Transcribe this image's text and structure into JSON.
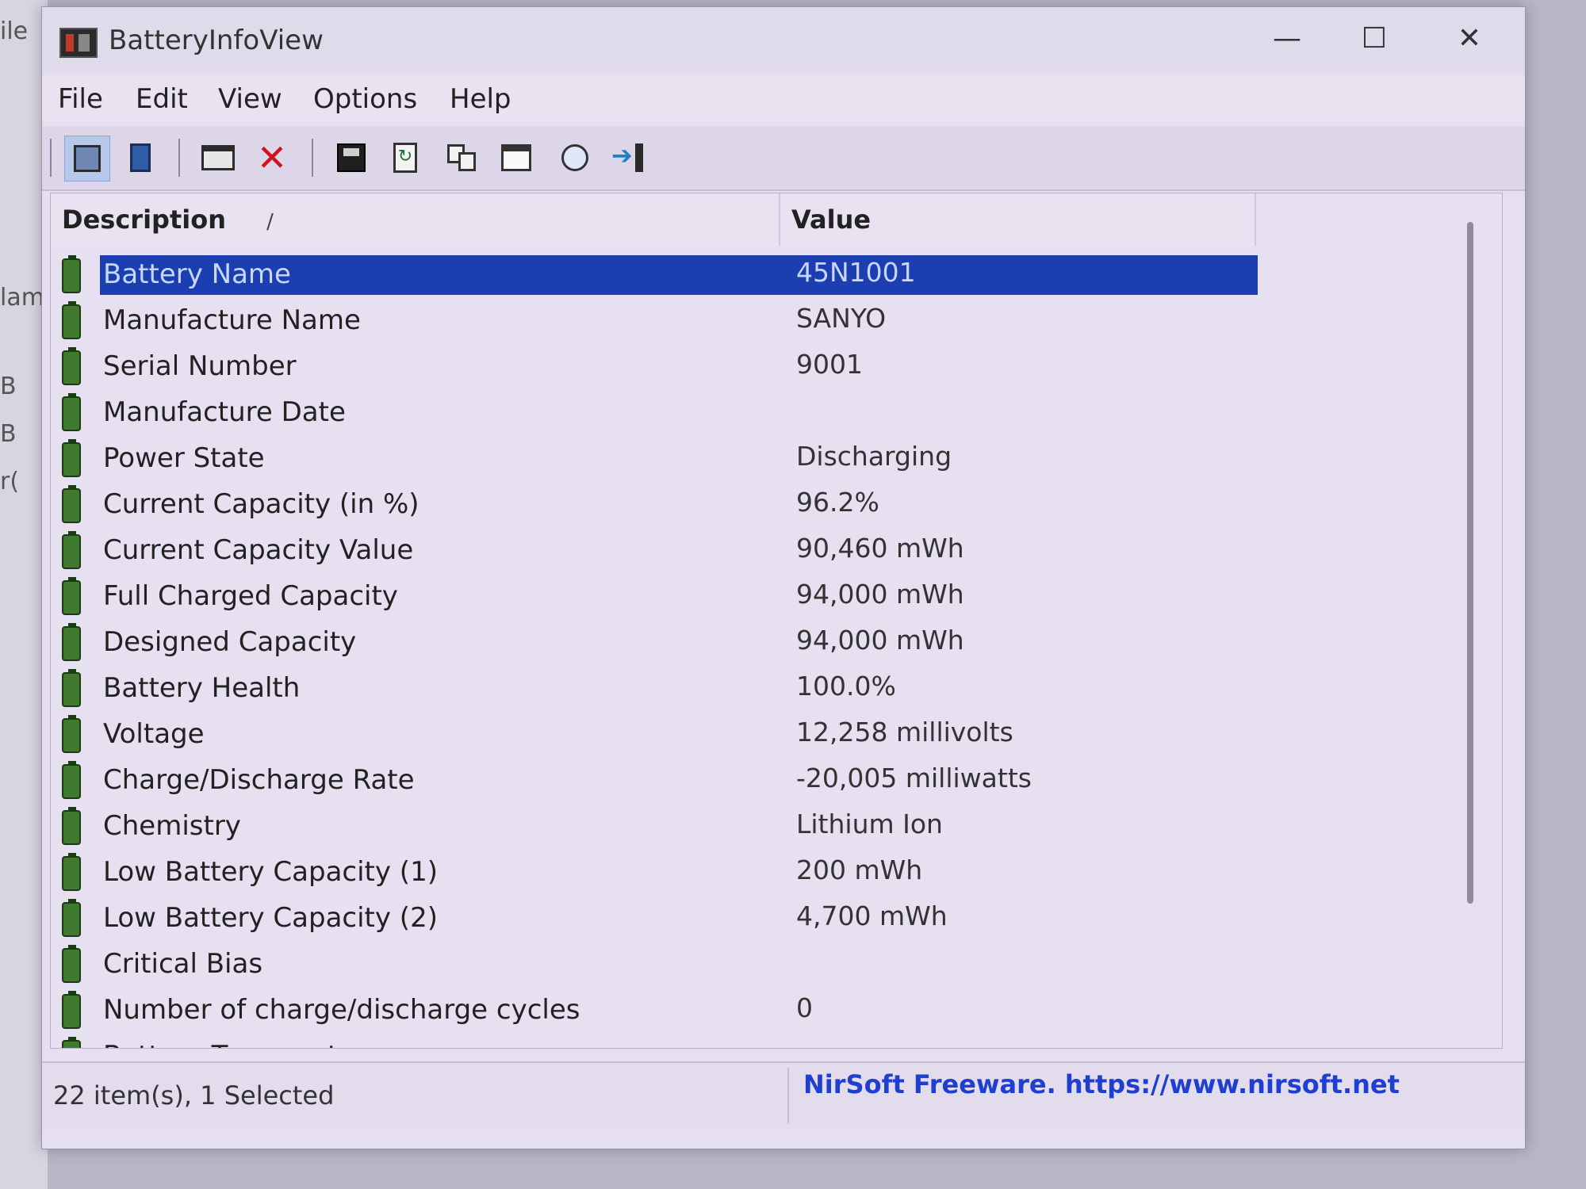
{
  "window": {
    "title": "BatteryInfoView",
    "minimize": "—",
    "maximize": "☐",
    "close": "✕"
  },
  "background": {
    "fragments": [
      "ile",
      "lam",
      "B",
      "B",
      "r("
    ]
  },
  "menu": [
    "File",
    "Edit",
    "View",
    "Options",
    "Help"
  ],
  "list": {
    "columns": {
      "description": "Description",
      "sort": "/",
      "value": "Value"
    },
    "rows": [
      {
        "description": "Battery Name",
        "value": "45N1001",
        "selected": true
      },
      {
        "description": "Manufacture Name",
        "value": "SANYO"
      },
      {
        "description": "Serial Number",
        "value": "9001"
      },
      {
        "description": "Manufacture Date",
        "value": ""
      },
      {
        "description": "Power State",
        "value": "Discharging"
      },
      {
        "description": "Current Capacity (in %)",
        "value": "96.2%"
      },
      {
        "description": "Current Capacity Value",
        "value": "90,460 mWh"
      },
      {
        "description": "Full Charged Capacity",
        "value": "94,000 mWh"
      },
      {
        "description": "Designed Capacity",
        "value": "94,000 mWh"
      },
      {
        "description": "Battery Health",
        "value": "100.0%"
      },
      {
        "description": "Voltage",
        "value": "12,258 millivolts"
      },
      {
        "description": "Charge/Discharge Rate",
        "value": "-20,005 milliwatts"
      },
      {
        "description": "Chemistry",
        "value": "Lithium Ion"
      },
      {
        "description": "Low Battery Capacity (1)",
        "value": "200 mWh"
      },
      {
        "description": "Low Battery Capacity (2)",
        "value": "4,700 mWh"
      },
      {
        "description": "Critical Bias",
        "value": ""
      },
      {
        "description": "Number of charge/discharge cycles",
        "value": "0"
      },
      {
        "description": "Battery Temperature",
        "value": ""
      }
    ]
  },
  "status": {
    "items": "22 item(s), 1 Selected",
    "link": "NirSoft Freeware. https://www.nirsoft.net"
  },
  "colors": {
    "selection": "#1b3fb0",
    "link": "#1f3fd0",
    "battery_icon": "#3f7a2e"
  }
}
